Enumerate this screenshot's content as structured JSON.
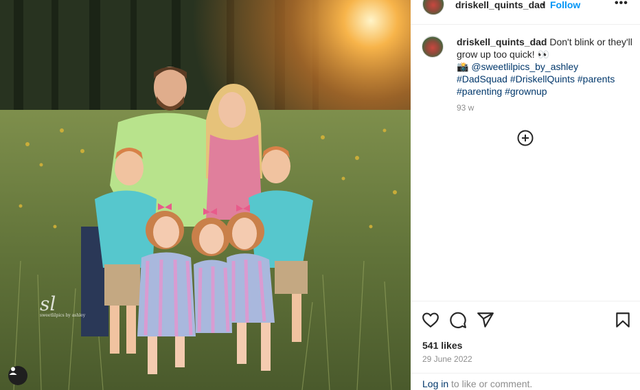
{
  "post": {
    "username": "driskell_quints_dad",
    "dot": "•",
    "follow_label": "Follow",
    "more_label": "•••",
    "caption": {
      "username": "driskell_quints_dad",
      "text": " Don't blink or they'll grow up too quick! 👀",
      "camera": "📸",
      "mention": "@sweetlilpics_by_ashley",
      "hashtags": [
        "#DadSquad",
        "#DriskellQuints",
        "#parents",
        "#parenting",
        "#grownup"
      ]
    },
    "time_ago": "93 w",
    "likes": "541 likes",
    "date": "29 June 2022",
    "comment_login": "Log in",
    "comment_rest": " to like or comment.",
    "photo_watermark": "sweetlilpics by ashley"
  },
  "icons": {
    "like": "heart-icon",
    "comment": "comment-icon",
    "share": "share-icon",
    "save": "bookmark-icon",
    "add_comment": "plus-circle-icon",
    "user_tag": "user-icon"
  },
  "colors": {
    "link": "#00376b",
    "follow": "#0095f6",
    "muted": "#8e8e8e"
  }
}
